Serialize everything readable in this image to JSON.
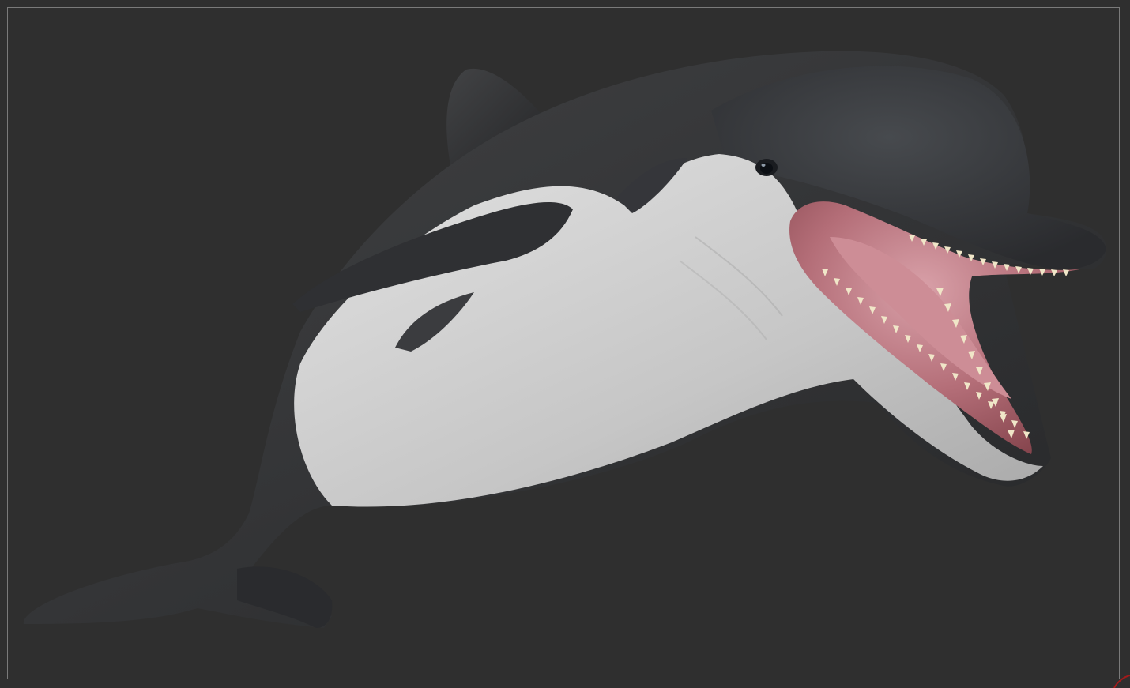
{
  "viewport": {
    "background": "#2f2f2f",
    "frame_color": "#7a7a7a"
  },
  "model": {
    "subject": "dolphin-sculpt",
    "colors": {
      "dorsal": "#3a3b3d",
      "belly": "#c9c9c9",
      "mouth": "#b0606a",
      "teeth": "#f0e6c8",
      "eye": "#0c0f14"
    }
  },
  "corner_mark": {
    "color": "#a31a1a"
  }
}
